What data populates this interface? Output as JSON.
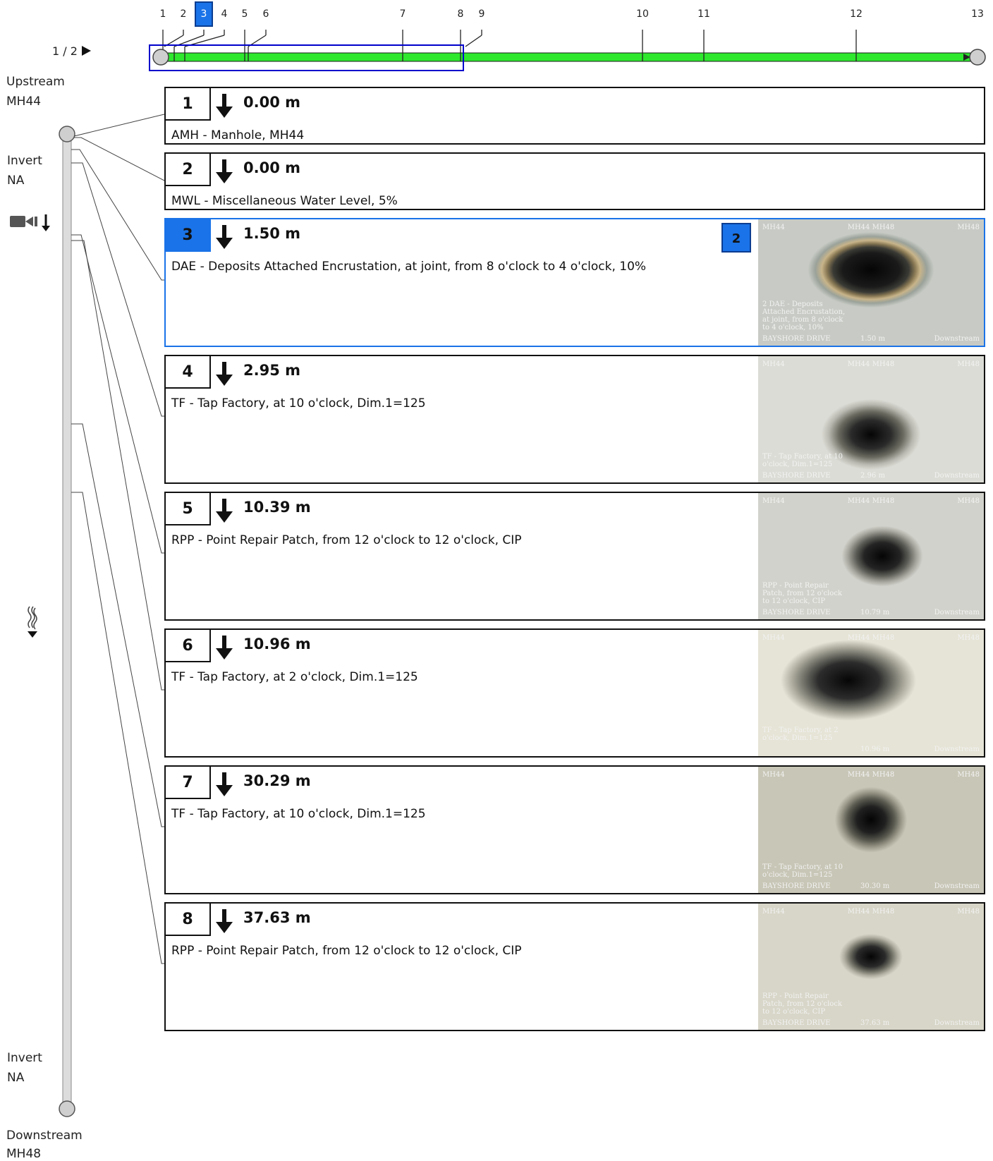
{
  "pager": {
    "text": "1 / 2"
  },
  "ticks": [
    "1",
    "2",
    "3",
    "4",
    "5",
    "6",
    "7",
    "8",
    "9",
    "10",
    "11",
    "12",
    "13"
  ],
  "selected_tick": "3",
  "upstream": {
    "label": "Upstream",
    "node": "MH44"
  },
  "upstream_invert": {
    "label": "Invert",
    "value": "NA"
  },
  "downstream_invert": {
    "label": "Invert",
    "value": "NA"
  },
  "downstream": {
    "label": "Downstream",
    "node": "MH48"
  },
  "colors": {
    "accent": "#1a73e8",
    "pipe": "#2ee82e",
    "frame": "#0000cc"
  },
  "observations": [
    {
      "num": "1",
      "dist": "0.00 m",
      "desc": "AMH - Manhole, MH44"
    },
    {
      "num": "2",
      "dist": "0.00 m",
      "desc": "MWL - Miscellaneous Water Level, 5%"
    },
    {
      "num": "3",
      "dist": "1.50 m",
      "desc": "DAE - Deposits Attached Encrustation, at joint, from 8 o'clock to 4 o'clock, 10%",
      "badge": "2",
      "photo": {
        "tl": "MH44",
        "tm": "MH44 MH48",
        "tr": "MH48",
        "ov": "2 DAE - Deposits Attached Encrustation, at joint, from 8 o'clock to 4 o'clock, 10%",
        "bl": "BAYSHORE DRIVE",
        "bm": "1.50 m",
        "br": "Downstream"
      }
    },
    {
      "num": "4",
      "dist": "2.95 m",
      "desc": "TF - Tap Factory, at 10 o'clock, Dim.1=125",
      "photo": {
        "tl": "MH44",
        "tm": "MH44 MH48",
        "tr": "MH48",
        "ov": "TF - Tap Factory, at 10 o'clock, Dim.1=125",
        "bl": "BAYSHORE DRIVE",
        "bm": "2.96 m",
        "br": "Downstream"
      }
    },
    {
      "num": "5",
      "dist": "10.39 m",
      "desc": "RPP - Point Repair Patch, from 12 o'clock to 12 o'clock, CIP",
      "photo": {
        "tl": "MH44",
        "tm": "MH44 MH48",
        "tr": "MH48",
        "ov": "RPP - Point Repair Patch, from 12 o'clock to 12 o'clock, CIP",
        "bl": "BAYSHORE DRIVE",
        "bm": "10.79 m",
        "br": "Downstream"
      }
    },
    {
      "num": "6",
      "dist": "10.96 m",
      "desc": "TF - Tap Factory, at 2 o'clock, Dim.1=125",
      "photo": {
        "tl": "MH44",
        "tm": "MH44 MH48",
        "tr": "MH48",
        "ov": "TF - Tap Factory, at 2 o'clock, Dim.1=125",
        "bl": "",
        "bm": "10.96 m",
        "br": "Downstream"
      }
    },
    {
      "num": "7",
      "dist": "30.29 m",
      "desc": "TF - Tap Factory, at 10 o'clock, Dim.1=125",
      "photo": {
        "tl": "MH44",
        "tm": "MH44 MH48",
        "tr": "MH48",
        "ov": "TF - Tap Factory, at 10 o'clock, Dim.1=125",
        "bl": "BAYSHORE DRIVE",
        "bm": "30.30 m",
        "br": "Downstream"
      }
    },
    {
      "num": "8",
      "dist": "37.63 m",
      "desc": "RPP - Point Repair Patch, from 12 o'clock to 12 o'clock, CIP",
      "photo": {
        "tl": "MH44",
        "tm": "MH44 MH48",
        "tr": "MH48",
        "ov": "RPP - Point Repair Patch, from 12 o'clock to 12 o'clock, CIP",
        "bl": "BAYSHORE DRIVE",
        "bm": "37.63 m",
        "br": "Downstream"
      }
    }
  ]
}
